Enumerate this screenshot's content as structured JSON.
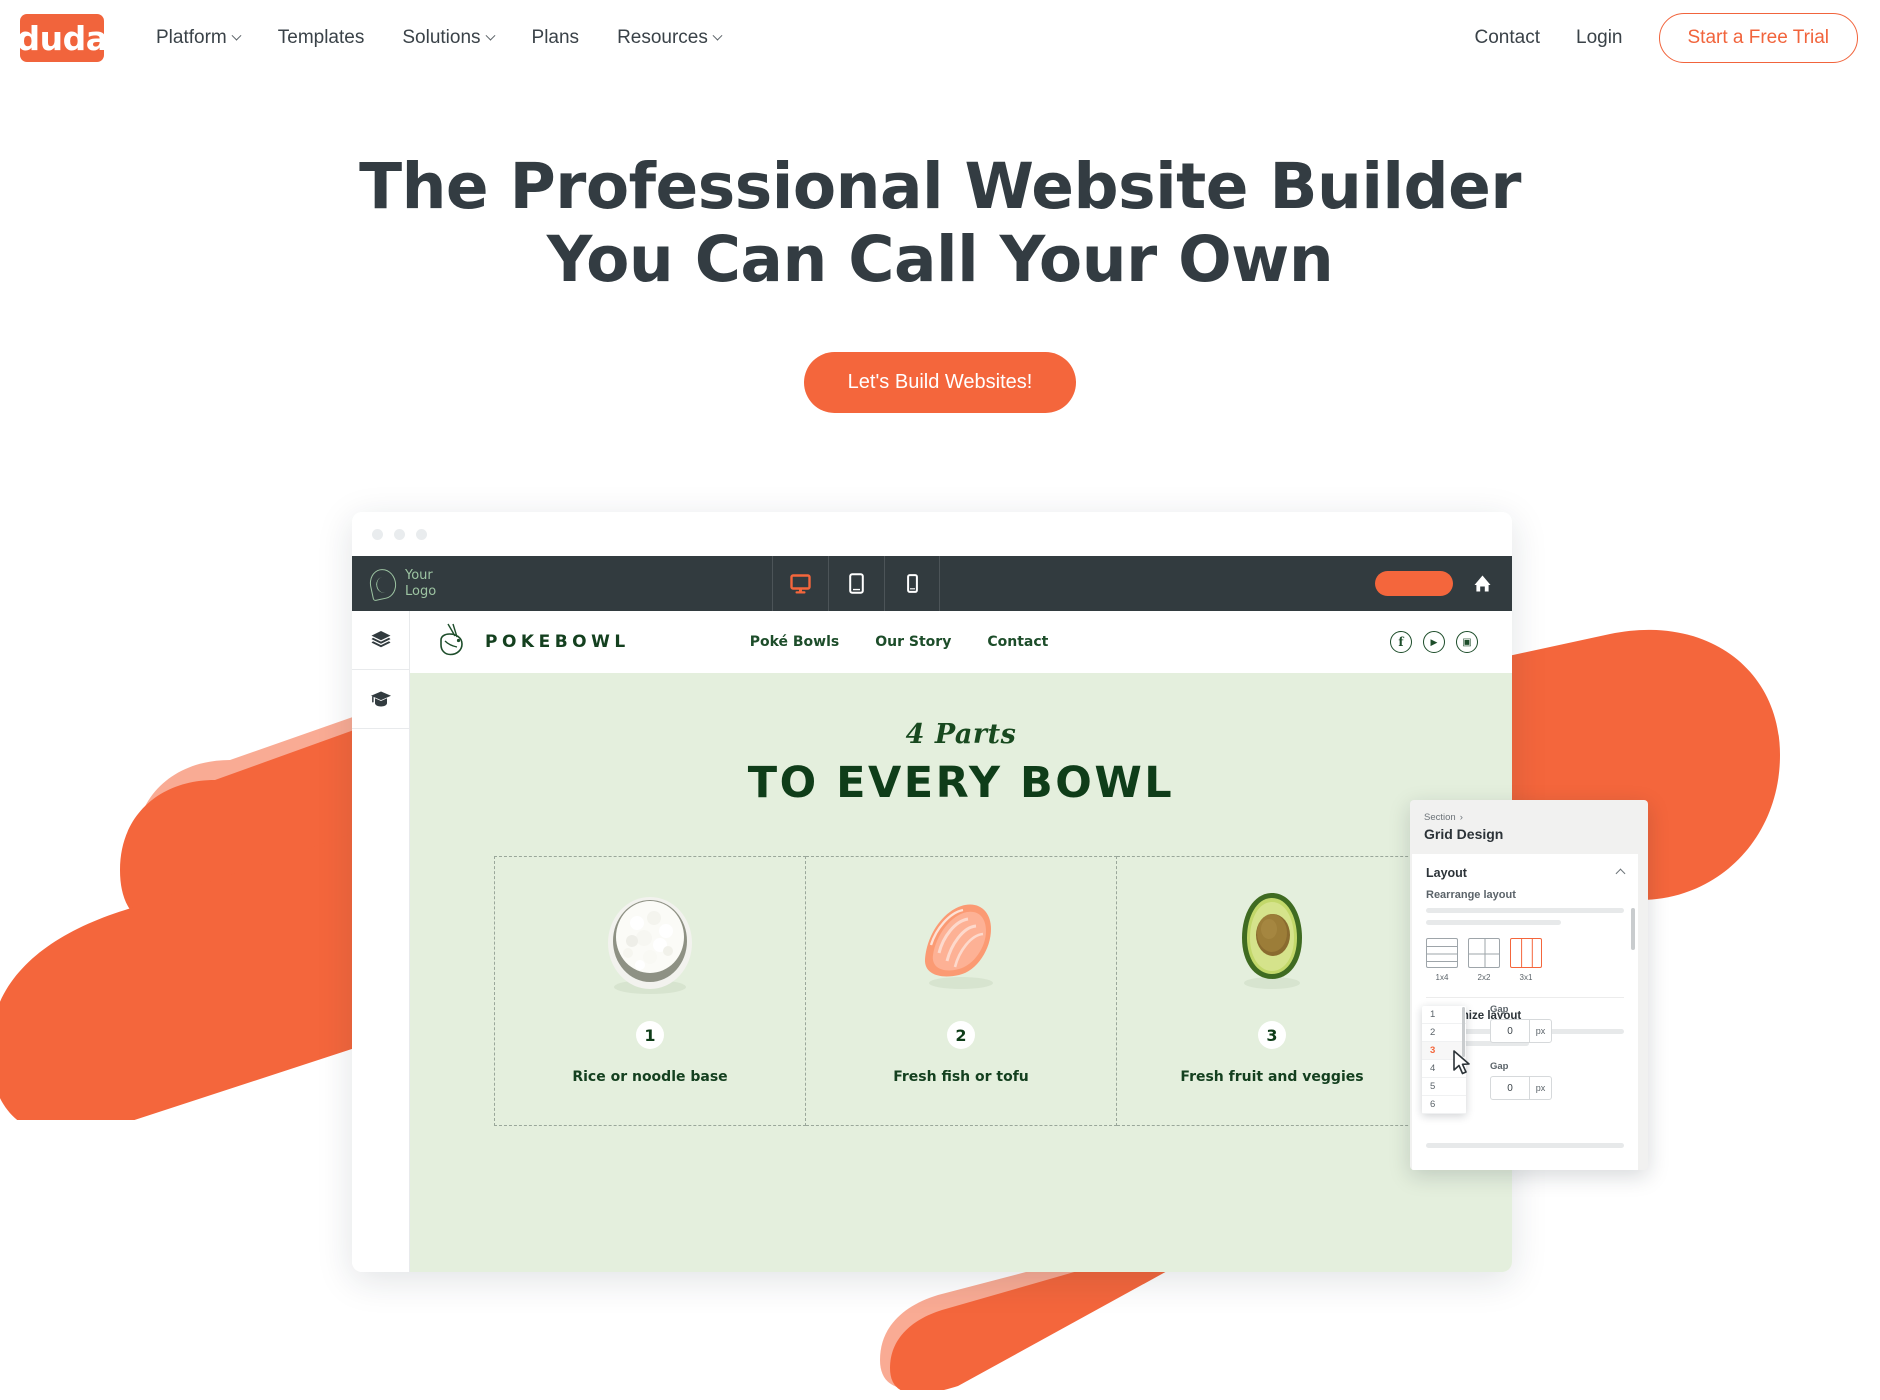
{
  "brand": {
    "name": "duda",
    "accent": "#f1643c"
  },
  "topnav": {
    "items": [
      {
        "label": "Platform",
        "caret": true,
        "icon": "chevron-down-icon"
      },
      {
        "label": "Templates",
        "caret": false,
        "icon": ""
      },
      {
        "label": "Solutions",
        "caret": true,
        "icon": "chevron-down-icon"
      },
      {
        "label": "Plans",
        "caret": false,
        "icon": ""
      },
      {
        "label": "Resources",
        "caret": true,
        "icon": "chevron-down-icon"
      }
    ],
    "contact": "Contact",
    "login": "Login",
    "trial_button": "Start a Free Trial"
  },
  "hero": {
    "headline_line1": "The Professional Website Builder",
    "headline_line2": "You Can Call Your Own",
    "cta_label": "Let's Build Websites!"
  },
  "editor": {
    "logo_line1": "Your",
    "logo_line2": "Logo",
    "devices": [
      {
        "name": "desktop-view-icon",
        "active": true
      },
      {
        "name": "tablet-view-icon",
        "active": false
      },
      {
        "name": "mobile-view-icon",
        "active": false
      }
    ],
    "publish_button": "",
    "home_icon": "home-icon",
    "sidebar": [
      {
        "icon": "layers-icon"
      },
      {
        "icon": "graduation-cap-icon"
      }
    ]
  },
  "site": {
    "brand": "POKEBOWL",
    "logo_icon": "pokebowl-chopsticks-icon",
    "nav": [
      "Poké Bowls",
      "Our Story",
      "Contact"
    ],
    "social": [
      {
        "icon": "facebook-icon",
        "glyph": "f"
      },
      {
        "icon": "youtube-icon",
        "glyph": "▶"
      },
      {
        "icon": "instagram-icon",
        "glyph": "▣"
      }
    ],
    "script_title": "4 Parts",
    "main_title": "TO EVERY BOWL",
    "cells": [
      {
        "number": "1",
        "caption": "Rice or noodle base",
        "image": "rice-bowl-photo"
      },
      {
        "number": "2",
        "caption": "Fresh fish or tofu",
        "image": "salmon-sashimi-photo"
      },
      {
        "number": "3",
        "caption": "Fresh fruit and veggies",
        "image": "avocado-half-photo"
      }
    ],
    "section_bg": "#e4efdd"
  },
  "panel": {
    "breadcrumb": "Section",
    "breadcrumb_arrow": "›",
    "title": "Grid Design",
    "section_title": "Layout",
    "collapse_icon": "caret-up-icon",
    "rearrange_label": "Rearrange layout",
    "layout_options": [
      {
        "label": "1x4",
        "selected": false,
        "kind": "rows4"
      },
      {
        "label": "2x2",
        "selected": false,
        "kind": "grid22"
      },
      {
        "label": "3x1",
        "selected": true,
        "kind": "cols3"
      }
    ],
    "customize_label": "Customize layout",
    "dropdown_options": [
      "1",
      "2",
      "3",
      "4",
      "5",
      "6"
    ],
    "dropdown_selected": "3",
    "gaps": [
      {
        "label": "Gap",
        "value": "0",
        "unit": "px"
      },
      {
        "label": "Gap",
        "value": "0",
        "unit": "px"
      }
    ],
    "cursor_icon": "mouse-pointer-icon"
  }
}
